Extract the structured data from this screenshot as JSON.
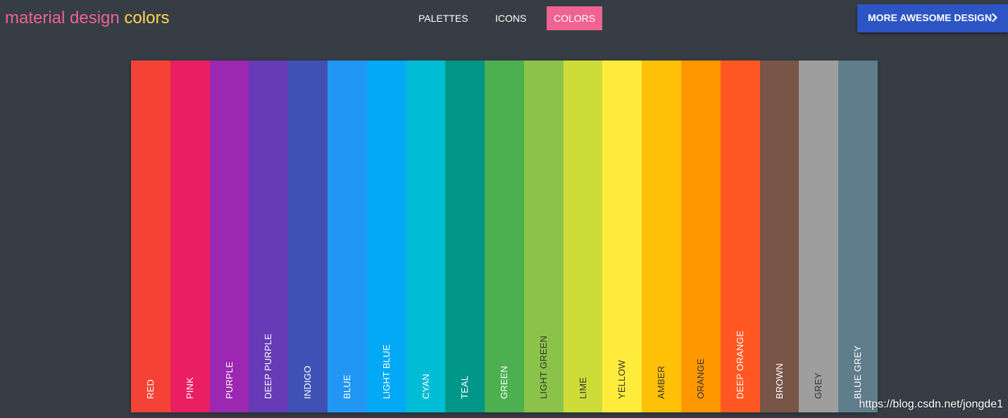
{
  "header": {
    "logo_word1": "material design",
    "logo_word2": "colors",
    "logo_color1": "#f06292",
    "logo_color2": "#ffd54f"
  },
  "nav": {
    "items": [
      {
        "label": "PALETTES",
        "active": false
      },
      {
        "label": "ICONS",
        "active": false
      },
      {
        "label": "COLORS",
        "active": true
      }
    ],
    "active_bg": "#f06292"
  },
  "cta": {
    "label": "MORE AWESOME DESIGN",
    "icon": "chevron-right-icon",
    "bg": "#2c54c4"
  },
  "swatches": [
    {
      "name": "RED",
      "color": "#f44336",
      "text_color": "#ffffff"
    },
    {
      "name": "PINK",
      "color": "#e91e63",
      "text_color": "#ffffff"
    },
    {
      "name": "PURPLE",
      "color": "#9c27b0",
      "text_color": "#ffffff"
    },
    {
      "name": "DEEP PURPLE",
      "color": "#673ab7",
      "text_color": "#ffffff"
    },
    {
      "name": "INDIGO",
      "color": "#3f51b5",
      "text_color": "#ffffff"
    },
    {
      "name": "BLUE",
      "color": "#2196f3",
      "text_color": "#ffffff"
    },
    {
      "name": "LIGHT BLUE",
      "color": "#03a9f4",
      "text_color": "#ffffff"
    },
    {
      "name": "CYAN",
      "color": "#00bcd4",
      "text_color": "#ffffff"
    },
    {
      "name": "TEAL",
      "color": "#009688",
      "text_color": "#ffffff"
    },
    {
      "name": "GREEN",
      "color": "#4caf50",
      "text_color": "#ffffff"
    },
    {
      "name": "LIGHT GREEN",
      "color": "#8bc34a",
      "text_color": "#333333"
    },
    {
      "name": "LIME",
      "color": "#cddc39",
      "text_color": "#333333"
    },
    {
      "name": "YELLOW",
      "color": "#ffeb3b",
      "text_color": "#333333"
    },
    {
      "name": "AMBER",
      "color": "#ffc107",
      "text_color": "#333333"
    },
    {
      "name": "ORANGE",
      "color": "#ff9800",
      "text_color": "#333333"
    },
    {
      "name": "DEEP ORANGE",
      "color": "#ff5722",
      "text_color": "#ffffff"
    },
    {
      "name": "BROWN",
      "color": "#795548",
      "text_color": "#ffffff"
    },
    {
      "name": "GREY",
      "color": "#9e9e9e",
      "text_color": "#333333"
    },
    {
      "name": "BLUE GREY",
      "color": "#607d8b",
      "text_color": "#ffffff"
    }
  ],
  "watermark": "https://blog.csdn.net/jongde1"
}
